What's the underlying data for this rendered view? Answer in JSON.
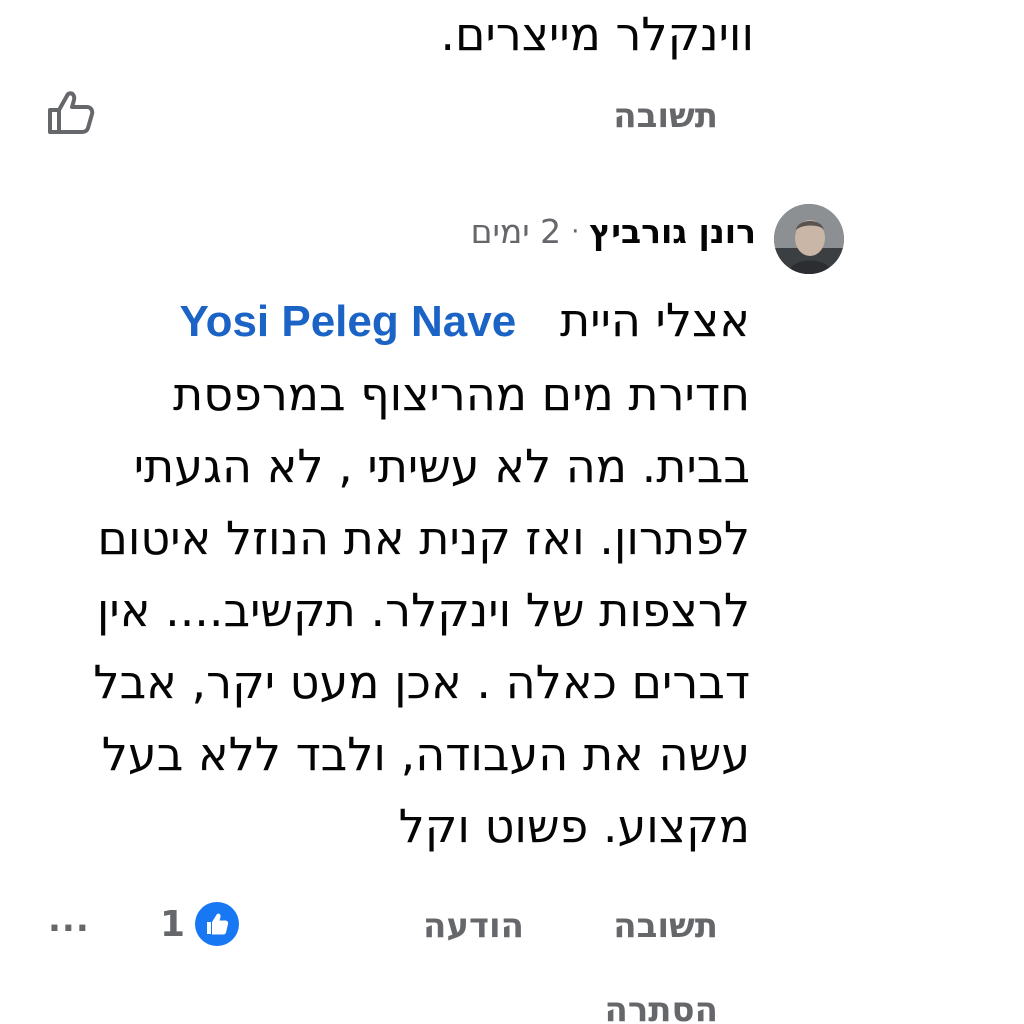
{
  "previous_comment": {
    "text_tail": "ווינקלר מייצרים.",
    "reply_label": "תשובה"
  },
  "comment": {
    "author": "רונן גורביץ",
    "separator": "·",
    "time": "2 ימים",
    "mention": "Yosi Peleg Nave",
    "first_line_prefix": "אצלי היית",
    "lines": [
      "חדירת מים מהריצוף במרפסת",
      "בבית. מה לא עשיתי , לא הגעתי",
      "לפתרון. ואז קנית את הנוזל איטום",
      "לרצפות של וינקלר. תקשיב.... אין",
      "דברים כאלה . אכן מעט יקר, אבל",
      "עשה את העבודה, ולבד ללא בעל",
      "מקצוע. פשוט וקל"
    ],
    "actions": {
      "reply_label": "תשובה",
      "report_label": "הודעה",
      "reaction_count": "1",
      "more_label": "...",
      "hide_label": "הסתרה"
    }
  },
  "icons": {
    "like_outline": "thumbs-up-outline-icon",
    "like_badge": "thumbs-up-badge-icon",
    "more": "more-options-icon"
  },
  "colors": {
    "mention": "#1b63c4",
    "secondary_text": "#65676b",
    "like_blue": "#1877f2"
  }
}
